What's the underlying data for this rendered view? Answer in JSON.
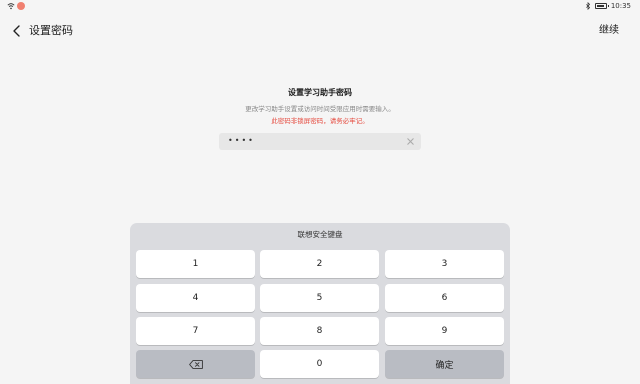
{
  "status_bar": {
    "time": "10:35",
    "battery_level": 0.9
  },
  "header": {
    "title": "设置密码",
    "continue_label": "继续"
  },
  "content": {
    "title": "设置学习助手密码",
    "description": "更改学习助手设置或访问时间受限应用时需要输入。",
    "warning": "此密码非锁屏密码，请务必牢记。",
    "password_mask": "••••"
  },
  "keyboard": {
    "title": "联想安全键盘",
    "keys": {
      "k1": "1",
      "k2": "2",
      "k3": "3",
      "k4": "4",
      "k5": "5",
      "k6": "6",
      "k7": "7",
      "k8": "8",
      "k9": "9",
      "k0": "0",
      "confirm": "确定"
    }
  },
  "colors": {
    "warning": "#e5483c",
    "keyboard_bg": "#dadbdf",
    "function_key": "#b9bcc3"
  }
}
